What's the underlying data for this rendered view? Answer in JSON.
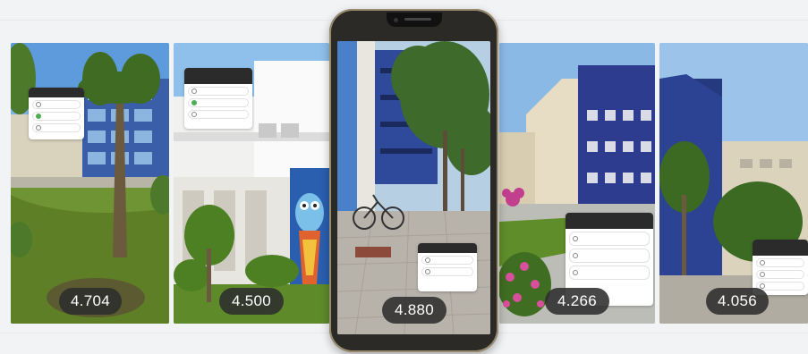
{
  "colors": {
    "badge_bg": "#2d2d2d",
    "phone_frame": "#2b2a27",
    "phone_trim": "#9a8c6e",
    "building_blue": "#2f3f8f",
    "building_cream": "#e6dcc3",
    "sky": "#6aa9e8",
    "grass": "#6c8f2e"
  },
  "cards": [
    {
      "id": "card-1",
      "rating": "4.704",
      "scene": "palm tree, blue glass building, lawn"
    },
    {
      "id": "card-2",
      "rating": "4.500",
      "scene": "white building with owl mural"
    },
    {
      "id": "card-3-phone",
      "rating": "4.880",
      "scene": "courtyard with trees and bicycle"
    },
    {
      "id": "card-4",
      "rating": "4.266",
      "scene": "blue and cream buildings, pink flowers"
    },
    {
      "id": "card-5",
      "rating": "4.056",
      "scene": "tall blue building with tree"
    }
  ],
  "icons": {
    "poll": "poll-sticker-icon",
    "radio": "radio-dot-icon",
    "phone_camera": "front-camera-icon"
  }
}
